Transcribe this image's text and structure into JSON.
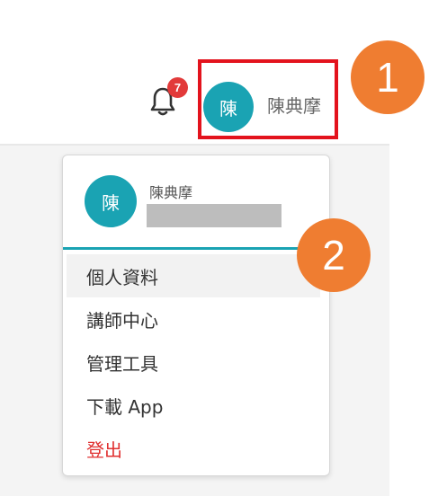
{
  "header": {
    "notification_count": "7",
    "user_avatar_initial": "陳",
    "user_name": "陳典摩"
  },
  "callouts": [
    "1",
    "2"
  ],
  "dropdown": {
    "avatar_initial": "陳",
    "name": "陳典摩",
    "menu": [
      {
        "label": "個人資料"
      },
      {
        "label": "講師中心"
      },
      {
        "label": "管理工具"
      },
      {
        "label": "下載 App"
      },
      {
        "label": "登出"
      }
    ]
  },
  "colors": {
    "accent": "#1aa3b3",
    "highlight_box": "#e3131d",
    "callout": "#ef7d31",
    "badge": "#e23a3a",
    "logout": "#e02f2f"
  }
}
